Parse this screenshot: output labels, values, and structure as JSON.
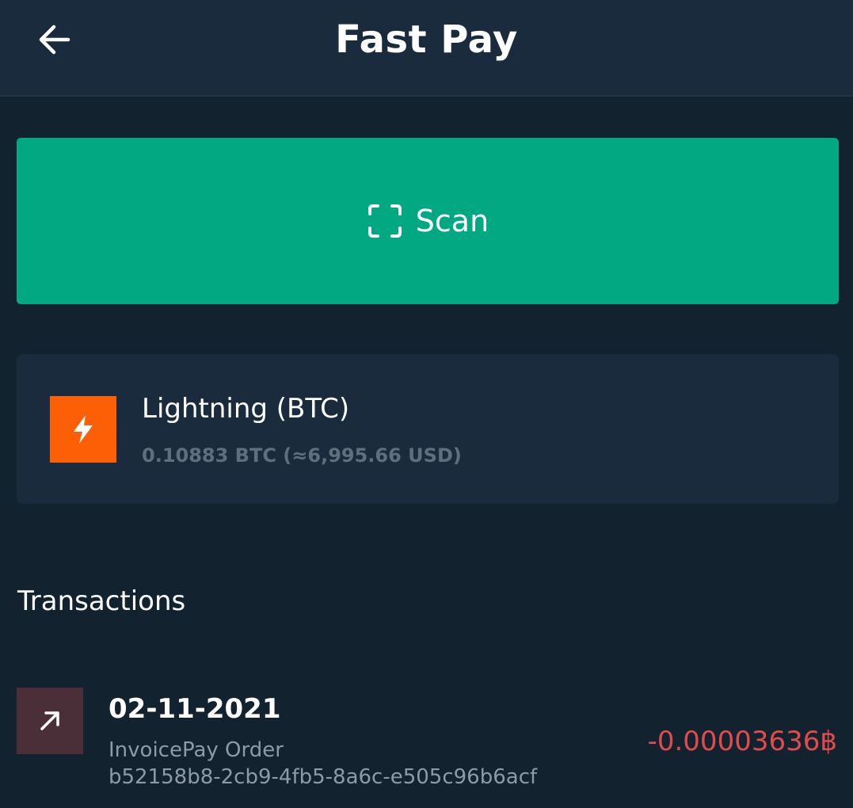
{
  "header": {
    "title": "Fast Pay",
    "back_icon": "arrow-left-icon"
  },
  "scan": {
    "label": "Scan",
    "icon": "scan-frame-icon"
  },
  "wallet": {
    "name": "Lightning (BTC)",
    "balance": "0.10883 BTC (≈6,995.66 USD)",
    "icon": "lightning-bolt-icon",
    "icon_color": "#fd5f07"
  },
  "transactions": {
    "title": "Transactions",
    "items": [
      {
        "date": "02-11-2021",
        "description": "InvoicePay Order",
        "reference": "b52158b8-2cb9-4fb5-8a6c-e505c96b6acf",
        "amount": "-0.00003636฿",
        "icon": "arrow-up-right-icon"
      }
    ]
  },
  "colors": {
    "background": "#12222f",
    "header_background": "#192b3c",
    "accent_green": "#02a882",
    "negative_amount": "#e04c4c"
  }
}
